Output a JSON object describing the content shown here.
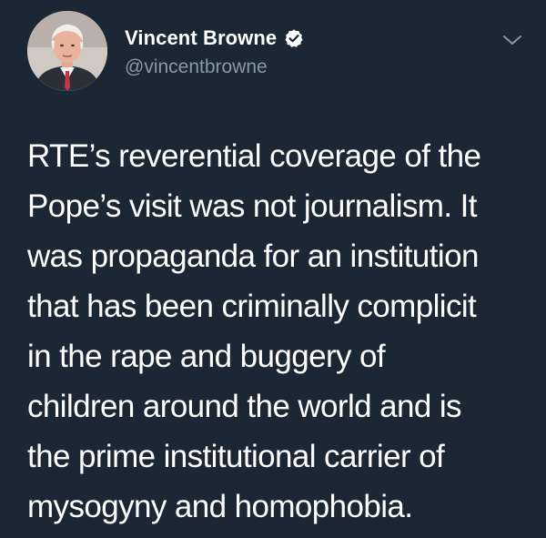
{
  "user": {
    "display_name": "Vincent Browne",
    "handle": "@vincentbrowne",
    "verified_icon": "verified-badge-icon",
    "avatar_icon": "avatar"
  },
  "menu": {
    "icon": "chevron-down-icon"
  },
  "tweet": {
    "text": "RTE’s reverential coverage of the\nPope’s visit was not journalism. It\nwas propaganda for an institution\nthat has been criminally complicit\nin the rape and buggery of\nchildren around the world and is\nthe prime institutional carrier of\nmysogyny and homophobia."
  },
  "colors": {
    "background": "#1b2734",
    "text": "#ffffff",
    "secondary_text": "#8899a6",
    "accent": "#ffffff"
  }
}
